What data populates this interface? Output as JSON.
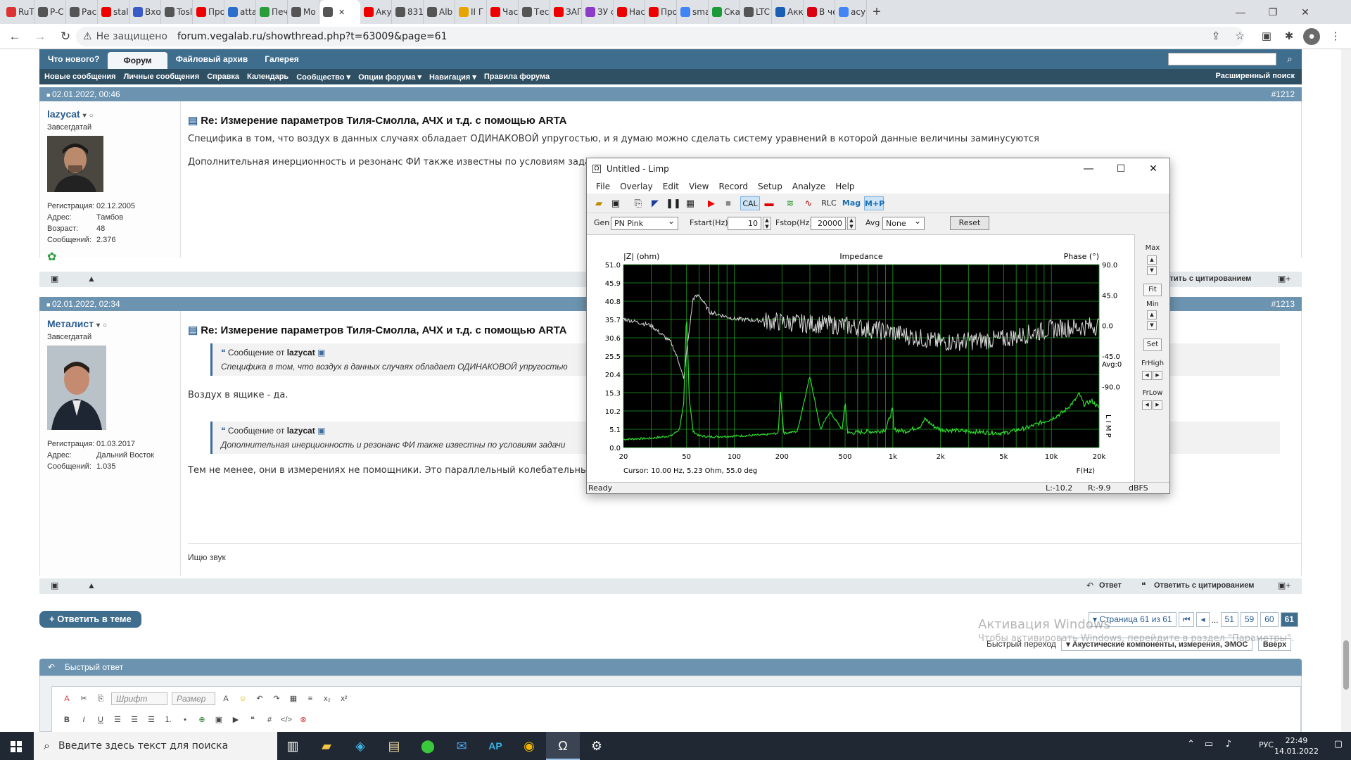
{
  "browser": {
    "tabs": [
      {
        "label": "RuT",
        "color": "#d33"
      },
      {
        "label": "P-C",
        "color": "#555"
      },
      {
        "label": "Рас",
        "color": "#555"
      },
      {
        "label": "stall",
        "color": "#e00"
      },
      {
        "label": "Вход",
        "color": "#3a5bc7"
      },
      {
        "label": "Tosl",
        "color": "#555"
      },
      {
        "label": "Про",
        "color": "#e00"
      },
      {
        "label": "atta",
        "color": "#2a6fc9"
      },
      {
        "label": "Печ",
        "color": "#2a9d3a"
      },
      {
        "label": "Мо",
        "color": "#555"
      },
      {
        "label": "",
        "color": "#555",
        "active": true
      },
      {
        "label": "Аку",
        "color": "#e00"
      },
      {
        "label": "831",
        "color": "#555"
      },
      {
        "label": "Alb",
        "color": "#555"
      },
      {
        "label": "II Г",
        "color": "#e8a400"
      },
      {
        "label": "Час",
        "color": "#e00"
      },
      {
        "label": "Тес",
        "color": "#555"
      },
      {
        "label": "ЗАГ",
        "color": "#e00"
      },
      {
        "label": "ЗУ с",
        "color": "#8a3cc7"
      },
      {
        "label": "Нас",
        "color": "#e00"
      },
      {
        "label": "Про",
        "color": "#e00"
      },
      {
        "label": "sma",
        "color": "#4285f4"
      },
      {
        "label": "Ска",
        "color": "#1c9a3a"
      },
      {
        "label": "LTC",
        "color": "#555"
      },
      {
        "label": "Акк",
        "color": "#1a5fb4"
      },
      {
        "label": "В че",
        "color": "#d01"
      },
      {
        "label": "acy",
        "color": "#4285f4"
      }
    ],
    "security_label": "Не защищено",
    "url": "forum.vegalab.ru/showthread.php?t=63009&page=61"
  },
  "forum": {
    "nav_primary": [
      "Что нового?",
      "Форум",
      "Файловый архив",
      "Галерея"
    ],
    "nav_secondary": [
      "Новые сообщения",
      "Личные сообщения",
      "Справка",
      "Календарь",
      "Сообщество ▾",
      "Опции форума ▾",
      "Навигация ▾",
      "Правила форума"
    ],
    "advanced_search": "Расширенный поиск",
    "posts": [
      {
        "date": "02.01.2022, 00:46",
        "number": "#1212",
        "username": "lazycat",
        "user_title": "Завсегдатай",
        "stats": [
          [
            "Регистрация:",
            "02.12.2005"
          ],
          [
            "Адрес:",
            "Тамбов"
          ],
          [
            "Возраст:",
            "48"
          ],
          [
            "Сообщений:",
            "2.376"
          ]
        ],
        "title": "Re: Измерение параметров Тиля-Смолла, АЧХ и т.д. с помощью ARTA",
        "text1": "Специфика в том, что воздух в данных случаях обладает ОДИНАКОВОЙ упругостью, и я думаю можно сделать систему уравнений в которой данные величины заминусуются",
        "text2": "Дополнительная инерционность и резонанс ФИ также известны по условиям задачи"
      },
      {
        "date": "02.01.2022, 02:34",
        "number": "#1213",
        "username": "Металист",
        "user_title": "Завсегдатай",
        "stats": [
          [
            "Регистрация:",
            "01.03.2017"
          ],
          [
            "Адрес:",
            "Дальний Восток"
          ],
          [
            "Сообщений:",
            "1.035"
          ]
        ],
        "title": "Re: Измерение параметров Тиля-Смолла, АЧХ и т.д. с помощью ARTA",
        "quote1_author": "lazycat",
        "quote1_text": "Специфика в том, что воздух в данных случаях обладает ОДИНАКОВОЙ упругостью",
        "reply1": "Воздух в ящике - да.",
        "quote2_author": "lazycat",
        "quote2_text": "Дополнительная инерционность и резонанс ФИ также известны по условиям задачи",
        "reply2": "Тем не менее, они в измерениях не помощники. Это параллельный колебательный контур, который живет своей жизнью.",
        "signature": "Ищю звук"
      }
    ],
    "quote_prefix": "Сообщение от",
    "reply_label": "Ответ",
    "reply_quote_label": "Ответить с цитированием",
    "reply_in_thread": "+ Ответить в теме",
    "pagination": {
      "summary": "▾ Страница 61 из 61",
      "first": "⏮",
      "prev": "◂",
      "ellipsis": "...",
      "pages": [
        "51",
        "59",
        "60",
        "61"
      ],
      "current": "61"
    },
    "quick_jump_label": "Быстрый переход",
    "quick_jump_value": "▾ Акустические компоненты, измерения, ЭМОС",
    "up_label": "Вверх",
    "quick_reply": "Быстрый ответ",
    "editor_font": "Шрифт",
    "editor_size": "Размер"
  },
  "limp": {
    "title": "Untitled - Limp",
    "menu": [
      "File",
      "Overlay",
      "Edit",
      "View",
      "Record",
      "Setup",
      "Analyze",
      "Help"
    ],
    "tool_text": {
      "cal": "CAL",
      "rlc": "RLC",
      "mag": "Mag",
      "mp": "M+P"
    },
    "gen_label": "Gen",
    "gen_value": "PN Pink",
    "fstart_label": "Fstart(Hz)",
    "fstart_value": "10",
    "fstop_label": "Fstop(Hz)",
    "fstop_value": "20000",
    "avg_label": "Avg",
    "avg_value": "None",
    "reset_label": "Reset",
    "side": {
      "max": "Max",
      "fit": "Fit",
      "min": "Min",
      "set": "Set",
      "frhigh": "FrHigh",
      "frlow": "FrLow"
    },
    "status": {
      "ready": "Ready",
      "left": "L:-10.2",
      "right": "R:-9.9",
      "unit": "dBFS"
    }
  },
  "chart_data": {
    "type": "line",
    "title": "Impedance",
    "ylabel": "|Z| (ohm)",
    "y2label": "Phase (°)",
    "xlabel": "F(Hz)",
    "xscale": "log",
    "xlim": [
      20,
      20000
    ],
    "ylim": [
      0,
      51.0
    ],
    "y2lim": [
      -180,
      90
    ],
    "yticks": [
      "51.0",
      "45.9",
      "40.8",
      "35.7",
      "30.6",
      "25.5",
      "20.4",
      "15.3",
      "10.2",
      "5.1",
      "0.0"
    ],
    "y2ticks": [
      "90.0",
      "45.0",
      "0.0",
      "-45.0",
      "-90.0"
    ],
    "xticks": [
      "20",
      "50",
      "100",
      "200",
      "500",
      "1k",
      "2k",
      "5k",
      "10k",
      "20k"
    ],
    "avg_label": "Avg:0",
    "side_label": "L I M P",
    "cursor": "Cursor: 10.00 Hz, 5.23 Ohm, 55.0 deg",
    "colors": {
      "background": "#000000",
      "grid": "#1f9a1f",
      "impedance": "#2fdc2f",
      "phase": "#d8d8d8"
    },
    "series": [
      {
        "name": "impedance",
        "x": [
          20,
          30,
          40,
          45,
          48,
          50,
          52,
          55,
          60,
          70,
          100,
          150,
          190,
          195,
          205,
          250,
          300,
          350,
          400,
          480,
          500,
          520,
          700,
          800,
          900,
          1000,
          1010,
          1200,
          1500,
          1600,
          1800,
          2000,
          3000,
          5000,
          7000,
          10000,
          12000,
          14000,
          15000,
          16000,
          18000,
          20000
        ],
        "y": [
          2.3,
          2.6,
          3.3,
          5.0,
          12.0,
          38.0,
          14.0,
          4.5,
          3.3,
          3.0,
          3.2,
          3.5,
          4.0,
          16.0,
          4.0,
          4.5,
          20.0,
          5.0,
          10.0,
          5.0,
          13.0,
          4.0,
          4.5,
          4.5,
          5.0,
          11.0,
          5.0,
          4.5,
          6.0,
          8.0,
          6.0,
          5.0,
          4.5,
          4.0,
          5.5,
          8.0,
          10.0,
          13.0,
          15.0,
          12.0,
          13.0,
          11.0
        ]
      },
      {
        "name": "phase",
        "x": [
          20,
          30,
          40,
          45,
          48,
          50,
          55,
          60,
          70,
          100,
          200,
          500,
          1000,
          2000,
          5000,
          10000,
          20000
        ],
        "y": [
          10,
          0,
          -25,
          -55,
          -80,
          -40,
          40,
          45,
          20,
          10,
          5,
          0,
          -10,
          -25,
          -20,
          -5,
          0
        ]
      }
    ]
  }
}
